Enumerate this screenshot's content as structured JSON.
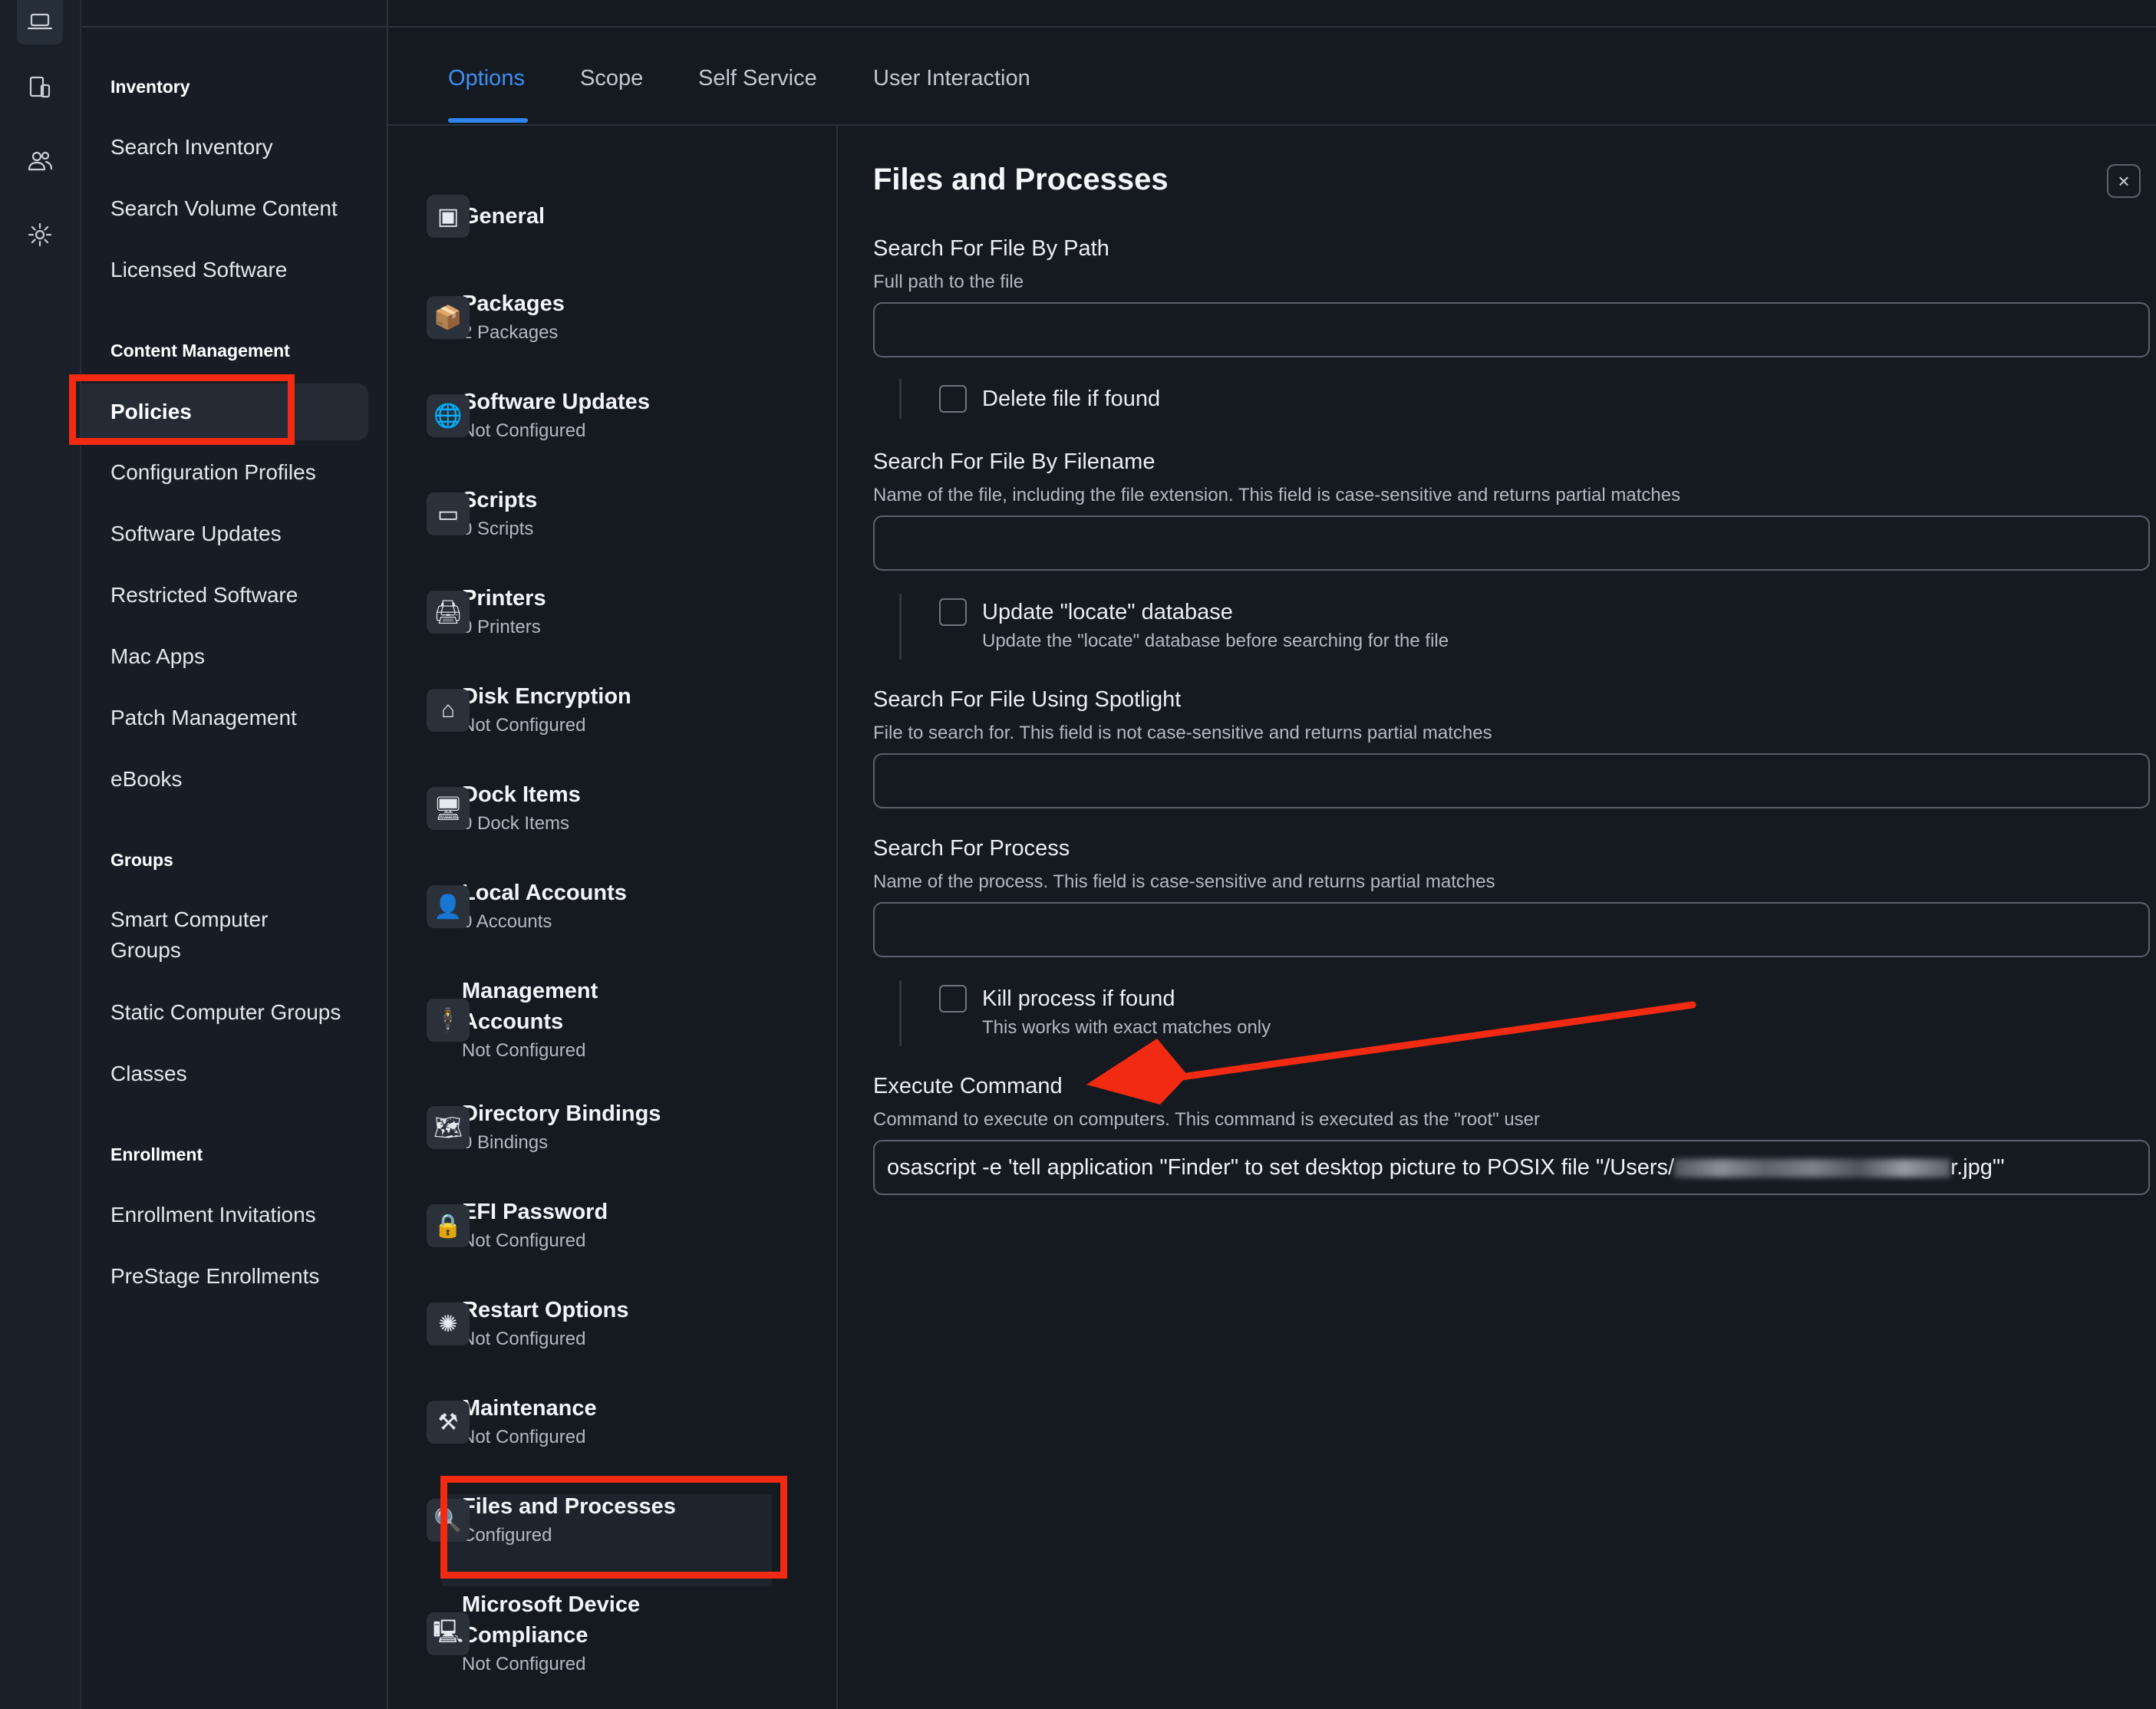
{
  "colors": {
    "accent": "#2f84f2",
    "annotation": "#f22a12",
    "background": "#151a21"
  },
  "rail": {
    "icons": [
      "laptop-icon",
      "device-icon",
      "users-icon",
      "gear-icon"
    ]
  },
  "nav": {
    "inventory": {
      "heading": "Inventory",
      "items": [
        "Search Inventory",
        "Search Volume Content",
        "Licensed Software"
      ]
    },
    "content": {
      "heading": "Content Management",
      "items": [
        "Policies",
        "Configuration Profiles",
        "Software Updates",
        "Restricted Software",
        "Mac Apps",
        "Patch Management",
        "eBooks"
      ]
    },
    "groups": {
      "heading": "Groups",
      "items": [
        "Smart Computer Groups",
        "Static Computer Groups",
        "Classes"
      ]
    },
    "enrollment": {
      "heading": "Enrollment",
      "items": [
        "Enrollment Invitations",
        "PreStage Enrollments"
      ]
    }
  },
  "tabs": [
    "Options",
    "Scope",
    "Self Service",
    "User Interaction"
  ],
  "payloads": [
    {
      "title": "General",
      "sub": "",
      "icon": "general-icon"
    },
    {
      "title": "Packages",
      "sub": "2 Packages",
      "icon": "package-icon"
    },
    {
      "title": "Software Updates",
      "sub": "Not Configured",
      "icon": "globe-icon"
    },
    {
      "title": "Scripts",
      "sub": "0 Scripts",
      "icon": "terminal-icon"
    },
    {
      "title": "Printers",
      "sub": "0 Printers",
      "icon": "printer-icon"
    },
    {
      "title": "Disk Encryption",
      "sub": "Not Configured",
      "icon": "house-lock-icon"
    },
    {
      "title": "Dock Items",
      "sub": "0 Dock Items",
      "icon": "monitor-icon"
    },
    {
      "title": "Local Accounts",
      "sub": "0 Accounts",
      "icon": "person-icon"
    },
    {
      "title": "Management Accounts",
      "sub": "Not Configured",
      "icon": "tuxedo-icon"
    },
    {
      "title": "Directory Bindings",
      "sub": "0 Bindings",
      "icon": "map-icon"
    },
    {
      "title": "EFI Password",
      "sub": "Not Configured",
      "icon": "padlock-icon"
    },
    {
      "title": "Restart Options",
      "sub": "Not Configured",
      "icon": "spinner-icon"
    },
    {
      "title": "Maintenance",
      "sub": "Not Configured",
      "icon": "tools-icon"
    },
    {
      "title": "Files and Processes",
      "sub": "Configured",
      "icon": "magnifier-icon"
    },
    {
      "title": "Microsoft Device Compliance",
      "sub": "Not Configured",
      "icon": "device-compliance-icon"
    }
  ],
  "detail": {
    "title": "Files and Processes",
    "close": "×",
    "path": {
      "label": "Search For File By Path",
      "help": "Full path to the file",
      "value": "",
      "checkbox": "Delete file if found"
    },
    "filename": {
      "label": "Search For File By Filename",
      "help": "Name of the file, including the file extension. This field is case-sensitive and returns partial matches",
      "value": "",
      "checkbox": "Update \"locate\" database",
      "checkbox_help": "Update the \"locate\" database before searching for the file"
    },
    "spotlight": {
      "label": "Search For File Using Spotlight",
      "help": "File to search for. This field is not case-sensitive and returns partial matches",
      "value": ""
    },
    "process": {
      "label": "Search For Process",
      "help": "Name of the process. This field is case-sensitive and returns partial matches",
      "value": "",
      "checkbox": "Kill process if found",
      "checkbox_help": "This works with exact matches only"
    },
    "command": {
      "label": "Execute Command",
      "help": "Command to execute on computers. This command is executed as the \"root\" user",
      "value_prefix": "osascript -e 'tell application \"Finder\" to set desktop picture to POSIX file \"/Users/",
      "value_suffix": "r.jpg\"'"
    }
  }
}
